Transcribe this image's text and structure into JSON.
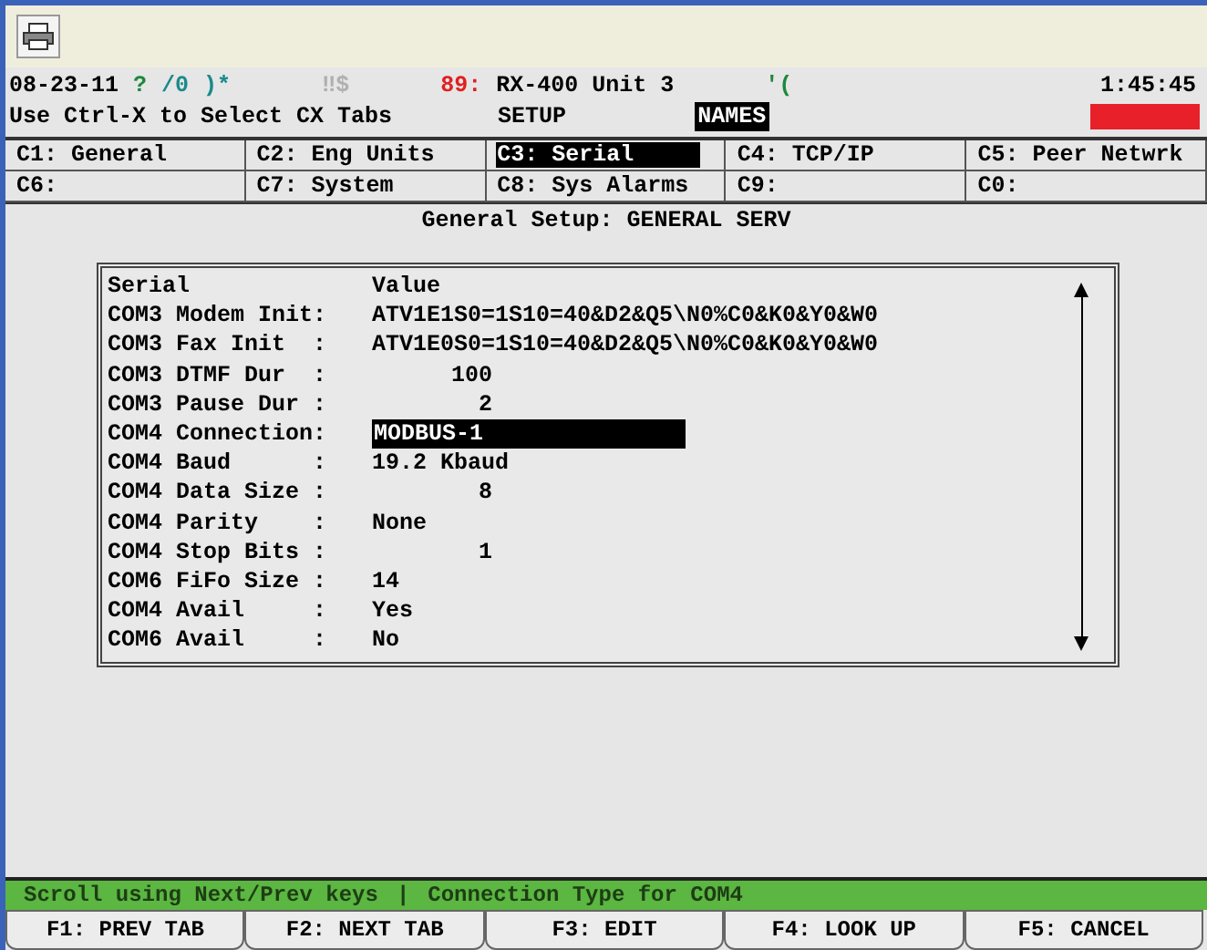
{
  "status_line": [
    {
      "text": "08-23-11",
      "color": "#000000"
    },
    {
      "text": "?",
      "color": "#1a8a3a"
    },
    {
      "text": "/0",
      "color": "#1a8a8a"
    },
    {
      "text": ")*",
      "color": "#1a8a8a"
    },
    {
      "text": "‼$",
      "color": "#b0b0b0"
    },
    {
      "text": "89:",
      "color": "#e02020"
    },
    {
      "text": "RX-400 Unit 3",
      "color": "#000000"
    },
    {
      "text": "'(",
      "color": "#1a8a3a"
    }
  ],
  "clock": "1:45:45",
  "hint": "Use Ctrl-X to Select CX Tabs",
  "mode": "SETUP",
  "names_badge": "NAMES",
  "tabs": [
    {
      "label": "C1: General",
      "selected": false
    },
    {
      "label": "C2: Eng Units",
      "selected": false
    },
    {
      "label": "C3: Serial",
      "selected": true
    },
    {
      "label": "C4: TCP/IP",
      "selected": false
    },
    {
      "label": "C5: Peer Netwrk",
      "selected": false
    },
    {
      "label": "C6:",
      "selected": false
    },
    {
      "label": "C7: System",
      "selected": false
    },
    {
      "label": "C8: Sys Alarms",
      "selected": false
    },
    {
      "label": "C9:",
      "selected": false
    },
    {
      "label": "C0:",
      "selected": false
    }
  ],
  "screen_title": "General Setup: GENERAL SERV",
  "table": {
    "columns": [
      "Serial",
      "Value"
    ],
    "rows": [
      {
        "label": "COM3 Modem Init:",
        "value": "ATV1E1S0=1S10=40&D2&Q5\\N0%C0&K0&Y0&W0",
        "kind": "text",
        "selected": false
      },
      {
        "label": "COM3 Fax Init  :",
        "value": "ATV1E0S0=1S10=40&D2&Q5\\N0%C0&K0&Y0&W0",
        "kind": "text",
        "selected": false
      },
      {
        "label": "COM3 DTMF Dur  :",
        "value": "100",
        "kind": "number",
        "selected": false
      },
      {
        "label": "COM3 Pause Dur :",
        "value": "2",
        "kind": "number",
        "selected": false
      },
      {
        "label": "COM4 Connection:",
        "value": "MODBUS-1",
        "kind": "text",
        "selected": true
      },
      {
        "label": "COM4 Baud      :",
        "value": "19.2 Kbaud",
        "kind": "text",
        "selected": false
      },
      {
        "label": "COM4 Data Size :",
        "value": "8",
        "kind": "number",
        "selected": false
      },
      {
        "label": "COM4 Parity    :",
        "value": "None",
        "kind": "text",
        "selected": false
      },
      {
        "label": "COM4 Stop Bits :",
        "value": "1",
        "kind": "number",
        "selected": false
      },
      {
        "label": "COM6 FiFo Size :",
        "value": "14",
        "kind": "text",
        "selected": false
      },
      {
        "label": "COM4 Avail     :",
        "value": "Yes",
        "kind": "text",
        "selected": false
      },
      {
        "label": "COM6 Avail     :",
        "value": "No",
        "kind": "text",
        "selected": false
      }
    ]
  },
  "status_bar": [
    "Scroll using Next/Prev keys",
    "|",
    "Connection Type for COM4"
  ],
  "function_keys": [
    "F1: PREV TAB",
    "F2: NEXT TAB",
    "F3: EDIT",
    "F4: LOOK UP",
    "F5: CANCEL"
  ]
}
